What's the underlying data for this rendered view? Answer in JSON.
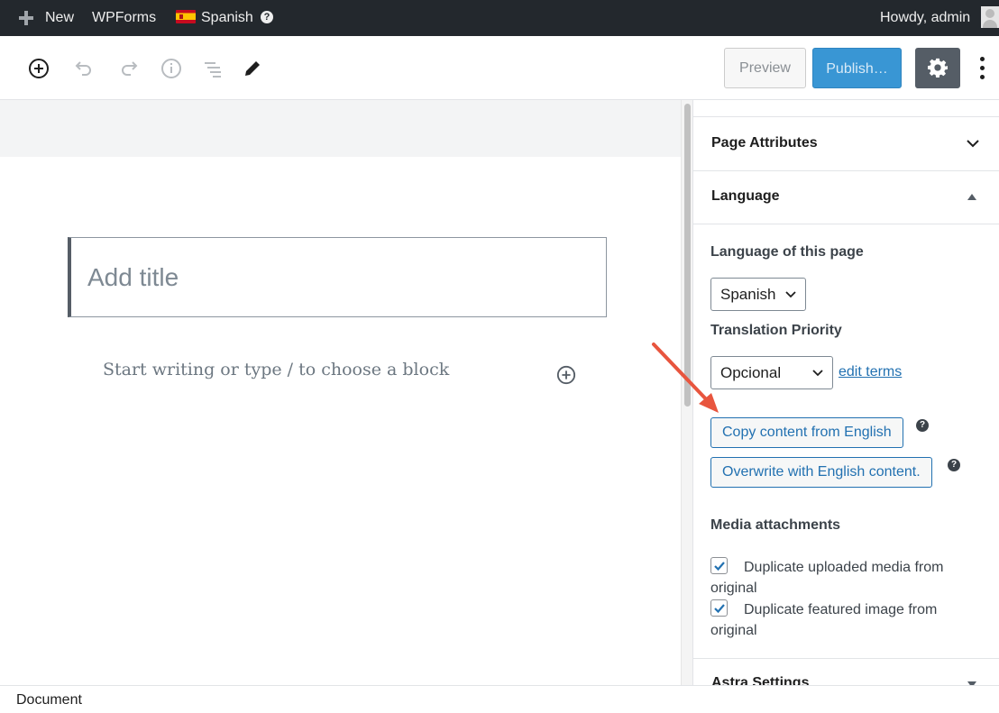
{
  "adminbar": {
    "new_label": "New",
    "wpforms_label": "WPForms",
    "language_label": "Spanish",
    "help_glyph": "?",
    "greeting": "Howdy, admin",
    "icons": [
      "plus-icon",
      "spain-flag-icon",
      "help-icon",
      "avatar-icon"
    ]
  },
  "toolbar": {
    "icons": [
      "add-block-icon",
      "undo-icon",
      "redo-icon",
      "info-icon",
      "outline-icon",
      "edit-tools-icon"
    ],
    "preview_label": "Preview",
    "publish_label": "Publish…",
    "settings_icon": "gear-icon",
    "more_icon": "more-vertical-icon"
  },
  "editor": {
    "title_placeholder": "Add title",
    "block_placeholder": "Start writing or type / to choose a block"
  },
  "sidebar": {
    "page_attributes": "Page Attributes",
    "language_panel": "Language",
    "language_of_page_label": "Language of this page",
    "language_value": "Spanish",
    "translation_priority_label": "Translation Priority",
    "priority_value": "Opcional",
    "edit_terms_link": "edit terms",
    "copy_button": "Copy content from English",
    "overwrite_button": "Overwrite with English content.",
    "help_glyph": "?",
    "media_heading": "Media attachments",
    "checkboxes": [
      {
        "label": "Duplicate uploaded media from original",
        "checked": true
      },
      {
        "label": "Duplicate featured image from original",
        "checked": true
      }
    ],
    "next_panel": "Astra Settings"
  },
  "footer": {
    "breadcrumb": "Document"
  },
  "colors": {
    "adminbar_bg": "#23282d",
    "publish_bg": "#3996d4",
    "settings_bg": "#555d66",
    "link": "#2271b1",
    "annotation_arrow": "#e8553e"
  }
}
